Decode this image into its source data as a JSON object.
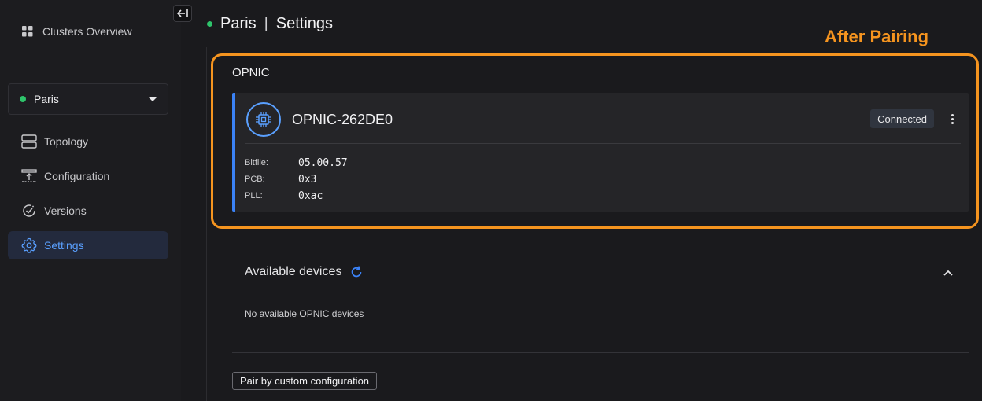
{
  "sidebar": {
    "overview_label": "Clusters Overview",
    "cluster_select": {
      "value": "Paris",
      "status_color": "#2ec46b"
    },
    "items": [
      {
        "label": "Topology",
        "icon": "topology-icon"
      },
      {
        "label": "Configuration",
        "icon": "configuration-icon"
      },
      {
        "label": "Versions",
        "icon": "versions-icon"
      },
      {
        "label": "Settings",
        "icon": "gear-icon",
        "active": true
      }
    ]
  },
  "header": {
    "cluster": "Paris",
    "separator": "|",
    "page": "Settings"
  },
  "annotation": {
    "label": "After Pairing",
    "color": "#f5941f"
  },
  "opnic": {
    "section_title": "OPNIC",
    "device": {
      "name": "OPNIC-262DE0",
      "status": "Connected",
      "properties": [
        {
          "key": "Bitfile:",
          "value": "05.00.57"
        },
        {
          "key": "PCB:",
          "value": "0x3"
        },
        {
          "key": "PLL:",
          "value": "0xac"
        }
      ]
    }
  },
  "available": {
    "title": "Available devices",
    "empty_text": "No available OPNIC devices"
  },
  "actions": {
    "pair_custom_label": "Pair by custom configuration"
  },
  "colors": {
    "accent": "#3b82f6",
    "active_text": "#5aa0ff",
    "background": "#1a1a1d"
  }
}
